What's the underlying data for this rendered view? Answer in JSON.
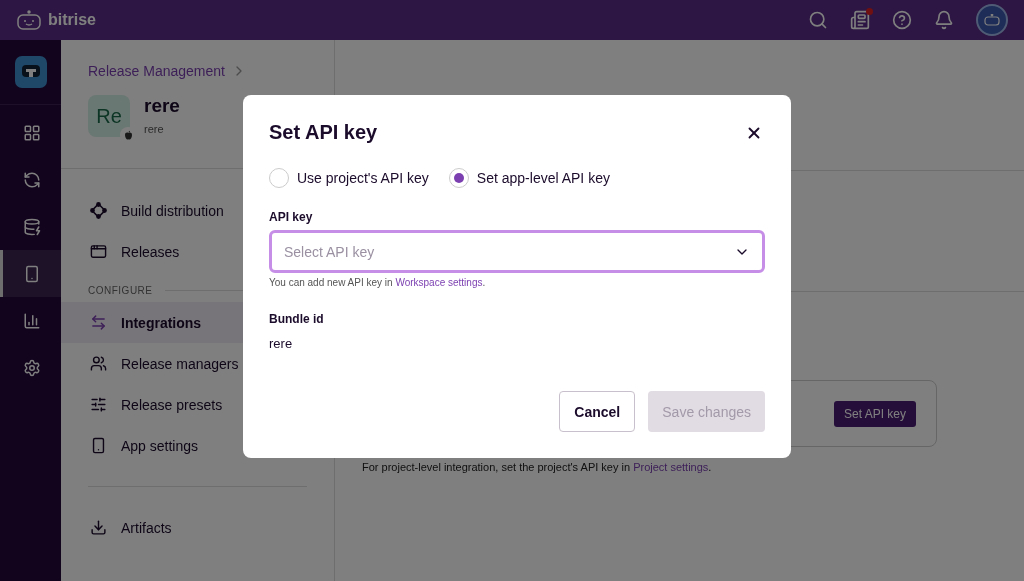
{
  "topbar": {
    "brand": "bitrise"
  },
  "rail": {
    "items": [
      {
        "kind": "grid",
        "selected": false
      },
      {
        "kind": "pipeline",
        "selected": false
      },
      {
        "kind": "cache",
        "selected": false
      },
      {
        "kind": "release",
        "selected": true
      },
      {
        "kind": "insights",
        "selected": false
      },
      {
        "kind": "settings",
        "selected": false
      }
    ]
  },
  "breadcrumb": {
    "label": "Release Management"
  },
  "app": {
    "avatar": "Re",
    "name": "rere",
    "subtitle": "rere"
  },
  "nav": {
    "items": [
      {
        "kind": "distribution",
        "label": "Build distribution",
        "selected": false
      },
      {
        "kind": "releases",
        "label": "Releases",
        "selected": false
      }
    ],
    "section": "CONFIGURE",
    "config_items": [
      {
        "kind": "integrations",
        "label": "Integrations",
        "selected": true
      },
      {
        "kind": "managers",
        "label": "Release managers",
        "selected": false
      },
      {
        "kind": "presets",
        "label": "Release presets",
        "selected": false
      },
      {
        "kind": "app",
        "label": "App settings",
        "selected": false
      }
    ],
    "bottom_items": [
      {
        "kind": "artifacts",
        "label": "Artifacts",
        "selected": false
      }
    ]
  },
  "content": {
    "card_button": "Set API key",
    "note": "For project-level integration, set the project's API key in ",
    "note_link": "Project settings",
    "note_end": "."
  },
  "modal": {
    "title": "Set API key",
    "radios": [
      {
        "label": "Use project's API key",
        "selected": false
      },
      {
        "label": "Set app-level API key",
        "selected": true
      }
    ],
    "field_label": "API key",
    "placeholder": "Select API key",
    "help": "You can add new API key in ",
    "help_link": "Workspace settings",
    "help_end": ".",
    "bundle_label": "Bundle id",
    "bundle_value": "rere",
    "buttons": [
      {
        "kind": "secondary",
        "label": "Cancel",
        "disabled": false
      },
      {
        "kind": "primary",
        "label": "Save changes",
        "disabled": true
      }
    ]
  }
}
